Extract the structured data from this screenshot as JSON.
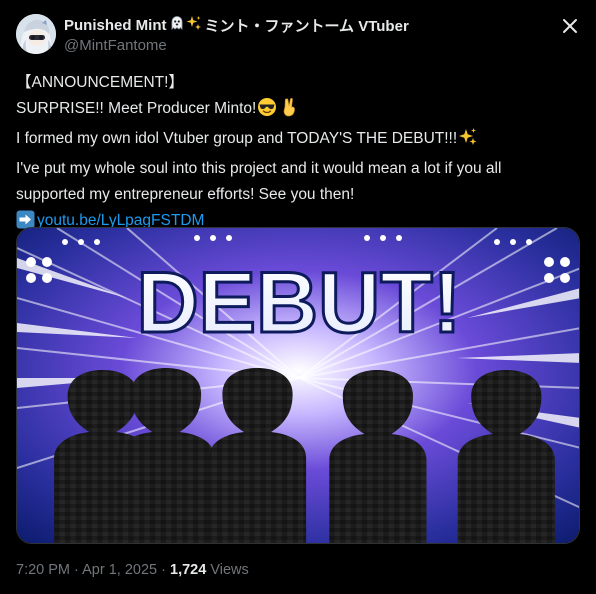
{
  "author": {
    "display_name": "Punished Mint",
    "name_suffix": "ミント・ファントーム VTuber",
    "handle": "@MintFantome"
  },
  "icons": {
    "avatar": "avatar-image",
    "name_emojis": [
      "ghost-icon",
      "sparkles-icon"
    ],
    "close": "close-icon",
    "inline_emojis": [
      "sunglasses-face-icon",
      "victory-hand-icon",
      "sparkles-icon",
      "right-arrow-icon"
    ]
  },
  "post": {
    "line1": "【ANNOUNCEMENT!】",
    "line2": "SURPRISE!! Meet Producer Minto!",
    "line3": "I formed my own idol Vtuber group and TODAY'S THE DEBUT!!!",
    "line4": "I've put my whole soul into this project and it would mean a lot if you all",
    "line5": "supported my entrepreneur efforts! See you then!",
    "link_text": "youtu.be/LyLpagFSTDM"
  },
  "media": {
    "headline": "DEBUT!",
    "silhouette_count": 5
  },
  "meta": {
    "time": "7:20 PM",
    "separator": "·",
    "date": "Apr 1, 2025",
    "views_count": "1,724",
    "views_label": "Views"
  },
  "colors": {
    "background": "#000000",
    "text": "#e7e9ea",
    "secondary": "#71767b",
    "link": "#1d9bf0",
    "border": "#2f3336"
  }
}
